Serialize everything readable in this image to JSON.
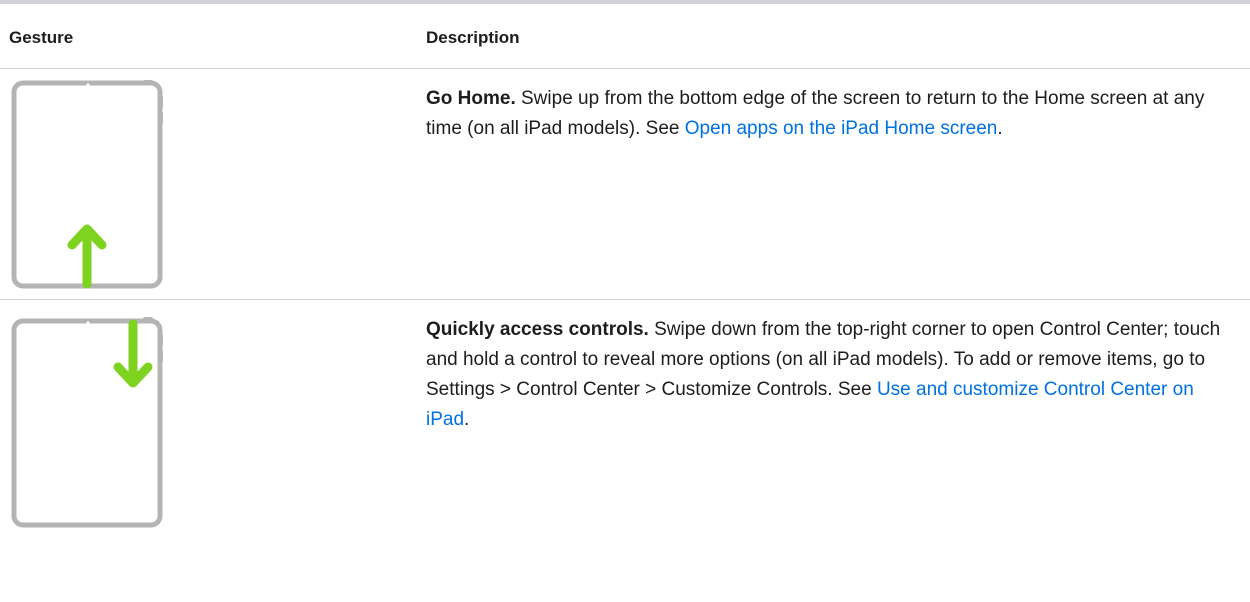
{
  "table": {
    "headers": {
      "gesture": "Gesture",
      "description": "Description"
    },
    "rows": [
      {
        "icon": "ipad-swipe-up-from-bottom-icon",
        "lead": "Go Home.",
        "text_before_link": " Swipe up from the bottom edge of the screen to return to the Home screen at any time (on all iPad models). See ",
        "link_text": "Open apps on the iPad Home screen",
        "text_after_link": "."
      },
      {
        "icon": "ipad-swipe-down-from-top-right-icon",
        "lead": "Quickly access controls.",
        "text_before_link": " Swipe down from the top-right corner to open Control Center; touch and hold a control to reveal more options (on all iPad models). To add or remove items, go to Settings > Control Center > Customize Controls. See ",
        "link_text": "Use and customize Control Center on iPad",
        "text_after_link": "."
      }
    ]
  },
  "colors": {
    "text": "#1d1d1f",
    "link": "#0071e3",
    "rule": "#d2d2d7",
    "device_outline": "#b4b4b4",
    "gesture_arrow": "#7ed321"
  }
}
